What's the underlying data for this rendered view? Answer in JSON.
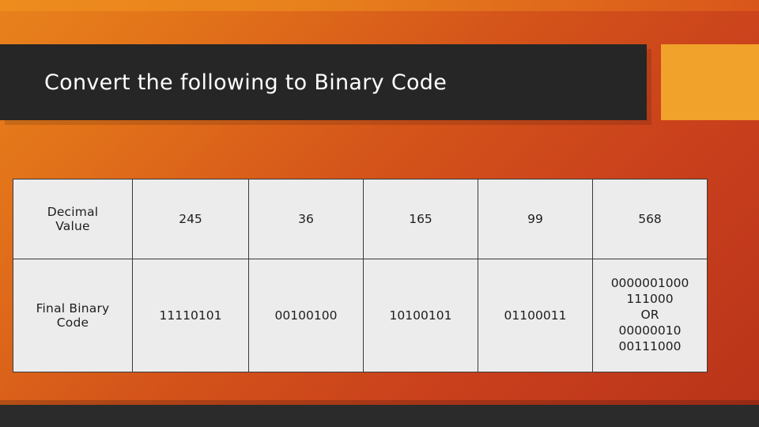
{
  "slide": {
    "title": "Convert the following to Binary Code",
    "colors": {
      "background_start": "#e8821c",
      "background_end": "#b8331a",
      "banner": "#262626",
      "accent_gold": "#f0a22a",
      "table_cell": "#ececec",
      "table_border": "#3a3a3a"
    }
  },
  "table": {
    "rows": [
      {
        "header": "Decimal Value",
        "header_lines": [
          "Decimal",
          "Value"
        ],
        "cells": [
          "245",
          "36",
          "165",
          "99",
          "568"
        ]
      },
      {
        "header": "Final Binary Code",
        "header_lines": [
          "Final Binary",
          "Code"
        ],
        "cells": [
          "11110101",
          "00100100",
          "10100101",
          "01100011",
          ""
        ],
        "last_cell_lines": [
          "0000001000",
          "111000",
          "OR",
          "00000010",
          "00111000"
        ]
      }
    ]
  }
}
